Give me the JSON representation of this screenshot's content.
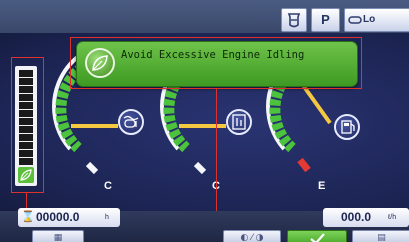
{
  "top_bar": {
    "buttons": [
      {
        "id": "filter",
        "icon": "filter-icon"
      },
      {
        "id": "park",
        "label": "P"
      },
      {
        "id": "lo",
        "label": "Lo",
        "icon": "lo-indicator-icon"
      }
    ]
  },
  "alert": {
    "message": "Avoid Excessive Engine Idling",
    "icon": "eco-leaf-icon",
    "color": "#4caf2e"
  },
  "left_meter": {
    "icon": "eco-leaf-icon",
    "segment_count": 14
  },
  "gauges": [
    {
      "id": "coolant-temp",
      "icon": "coolant-temperature-icon",
      "end_label": "C",
      "needle_color": "#f5c842"
    },
    {
      "id": "hydraulic-oil-temp",
      "icon": "hydraulic-oil-temperature-icon",
      "end_label": "C",
      "needle_color": "#f5c842"
    },
    {
      "id": "fuel",
      "icon": "fuel-pump-icon",
      "end_label": "E",
      "needle_color": "#f5c842"
    }
  ],
  "readouts": {
    "hour_meter": {
      "value": "00000.0",
      "unit": "h"
    },
    "fuel_rate": {
      "value": "000.0",
      "unit": "ℓ/h"
    }
  },
  "bottom_bar": {
    "softkeys": [
      {
        "id": "menu",
        "icon": "menu-icon"
      },
      {
        "id": "navigate",
        "icon": "navigate-icon"
      },
      {
        "id": "confirm",
        "icon": "checkmark-icon"
      },
      {
        "id": "info",
        "icon": "info-icon"
      }
    ]
  },
  "colors": {
    "background": "#1d2555",
    "highlight_box": "#e0302c",
    "gauge_green": "#4cc33c",
    "gauge_red": "#e53a34",
    "gauge_white": "#f4f6fb"
  }
}
